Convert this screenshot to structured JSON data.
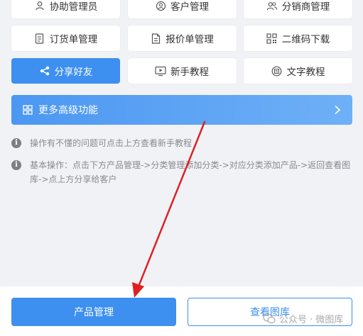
{
  "features": {
    "row1": [
      {
        "label": "协助管理员",
        "icon": "user-icon"
      },
      {
        "label": "客户管理",
        "icon": "customer-icon"
      },
      {
        "label": "分销商管理",
        "icon": "users-icon"
      }
    ],
    "row2": [
      {
        "label": "订货单管理",
        "icon": "document-icon"
      },
      {
        "label": "报价单管理",
        "icon": "quote-document-icon"
      },
      {
        "label": "二维码下载",
        "icon": "qr-code-icon"
      }
    ],
    "row3": [
      {
        "label": "分享好友",
        "icon": "share-icon",
        "active": true
      },
      {
        "label": "新手教程",
        "icon": "monitor-icon"
      },
      {
        "label": "文字教程",
        "icon": "text-tutorial-icon"
      }
    ]
  },
  "more_bar": {
    "label": "更多高级功能",
    "icon": "grid-icon",
    "chevron": "chevron-right-icon"
  },
  "tips": [
    {
      "text": "操作有不懂的问题可点击上方查看新手教程"
    },
    {
      "text": "基本操作：点击下方产品管理->分类管理添加分类->对应分类添加产品->返回查看图库->点上方分享给客户"
    }
  ],
  "bottom": {
    "primary_label": "产品管理",
    "secondary_label": "查看图库"
  },
  "watermark": {
    "text": "公众号 · 微图库"
  },
  "colors": {
    "accent": "#3d8ff0",
    "background": "#f1f2f6",
    "annotation_arrow": "#e02020"
  }
}
